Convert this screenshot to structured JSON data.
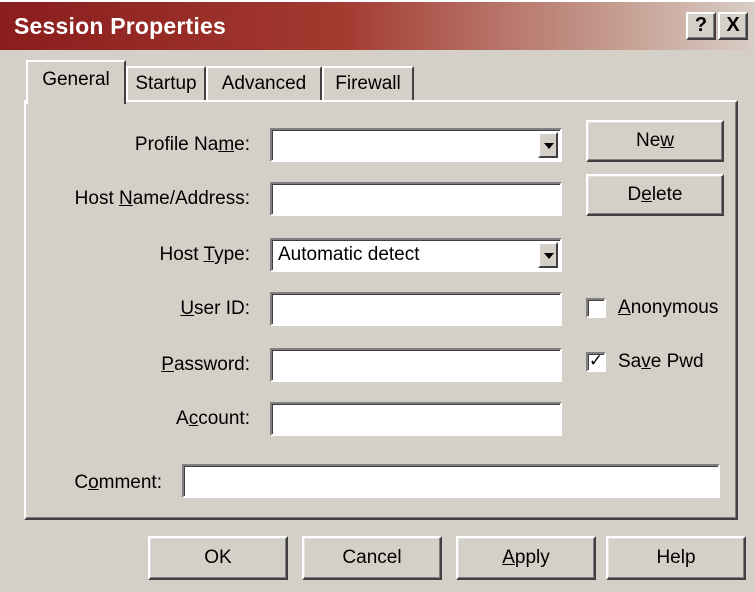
{
  "window": {
    "title": "Session Properties",
    "help_label": "?",
    "close_label": "X"
  },
  "tabs": [
    {
      "label": "General",
      "active": true
    },
    {
      "label": "Startup",
      "active": false
    },
    {
      "label": "Advanced",
      "active": false
    },
    {
      "label": "Firewall",
      "active": false
    }
  ],
  "form": {
    "profile_name": {
      "label_pre": "Profile Na",
      "label_ul": "m",
      "label_post": "e:",
      "value": ""
    },
    "host_name": {
      "label_pre": "Host ",
      "label_ul": "N",
      "label_post": "ame/Address:",
      "value": ""
    },
    "host_type": {
      "label_pre": "Host ",
      "label_ul": "T",
      "label_post": "ype:",
      "value": "Automatic detect"
    },
    "user_id": {
      "label_pre": "",
      "label_ul": "U",
      "label_post": "ser ID:",
      "value": ""
    },
    "password": {
      "label_pre": "",
      "label_ul": "P",
      "label_post": "assword:",
      "value": ""
    },
    "account": {
      "label_pre": "A",
      "label_ul": "c",
      "label_post": "count:",
      "value": ""
    },
    "comment": {
      "label_pre": "C",
      "label_ul": "o",
      "label_post": "mment:",
      "value": ""
    }
  },
  "side_buttons": {
    "new": {
      "pre": "Ne",
      "ul": "w",
      "post": ""
    },
    "delete": {
      "pre": "D",
      "ul": "e",
      "post": "lete"
    }
  },
  "checkboxes": {
    "anonymous": {
      "pre": "",
      "ul": "A",
      "post": "nonymous",
      "checked": false,
      "mark": ""
    },
    "save_pwd": {
      "pre": "Sa",
      "ul": "v",
      "post": "e Pwd",
      "checked": true,
      "mark": "✓"
    }
  },
  "bottom_buttons": {
    "ok": {
      "pre": "OK",
      "ul": "",
      "post": ""
    },
    "cancel": {
      "pre": "Cancel",
      "ul": "",
      "post": ""
    },
    "apply": {
      "pre": "",
      "ul": "A",
      "post": "pply"
    },
    "help": {
      "pre": "Help",
      "ul": "",
      "post": ""
    }
  }
}
